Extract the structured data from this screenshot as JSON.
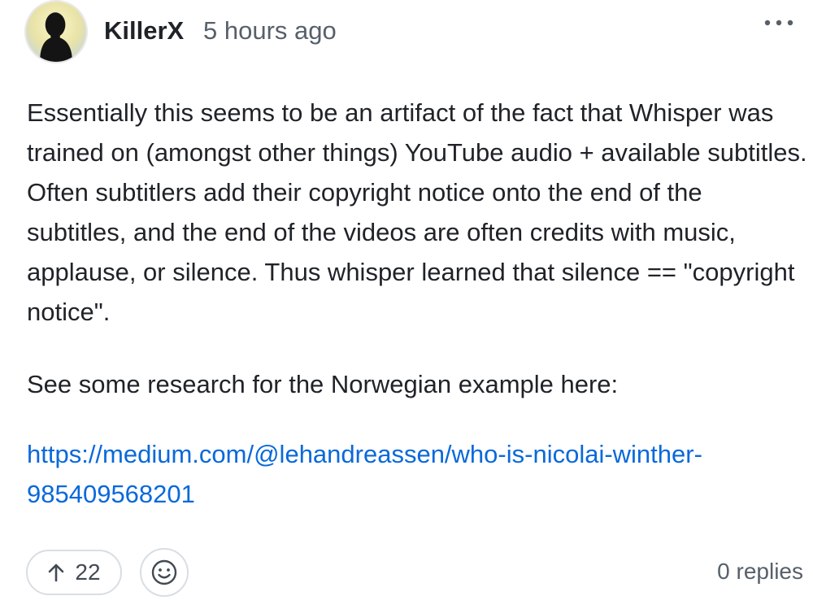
{
  "comment": {
    "author": "KillerX",
    "timestamp": "5 hours ago",
    "more_icon": "kebab-horizontal-icon",
    "paragraphs": [
      "Essentially this seems to be an artifact of the fact that Whisper was trained on (amongst other things) YouTube audio + available subtitles. Often subtitlers add their copyright notice onto the end of the subtitles, and the end of the videos are often credits with music, applause, or silence. Thus whisper learned that silence == \"copyright notice\".",
      "See some research for the Norwegian example here:"
    ],
    "link": "https://medium.com/@lehandreassen/who-is-nicolai-winther-985409568201"
  },
  "footer": {
    "upvote_icon": "arrow-up-icon",
    "upvote_count": "22",
    "reaction_icon": "smiley-icon",
    "replies_label": "0 replies"
  },
  "colors": {
    "text": "#1f2328",
    "muted": "#57606a",
    "link": "#0969da",
    "border": "#d8dee4"
  }
}
